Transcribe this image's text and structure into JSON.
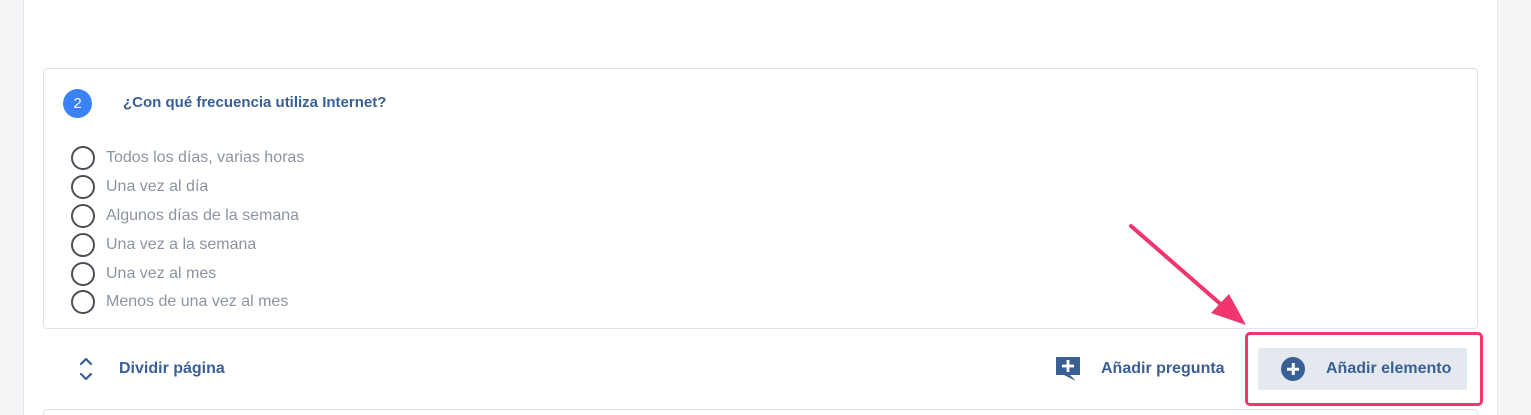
{
  "question": {
    "number": "2",
    "title": "¿Con qué frecuencia utiliza Internet?",
    "options": [
      "Todos los días, varias horas",
      "Una vez al día",
      "Algunos días de la semana",
      "Una vez a la semana",
      "Una vez al mes",
      "Menos de una vez al mes"
    ]
  },
  "toolbar": {
    "split_page_label": "Dividir página",
    "add_question_label": "Añadir pregunta",
    "add_element_label": "Añadir elemento"
  },
  "icons": {
    "split_page": "chevron-up-down-icon",
    "add_question": "add-comment-icon",
    "add_element": "plus-circle-icon"
  },
  "colors": {
    "accent": "#3a5f94",
    "badge": "#3b82f6",
    "annotation": "#f0356f",
    "option_text": "#8b95a1"
  }
}
